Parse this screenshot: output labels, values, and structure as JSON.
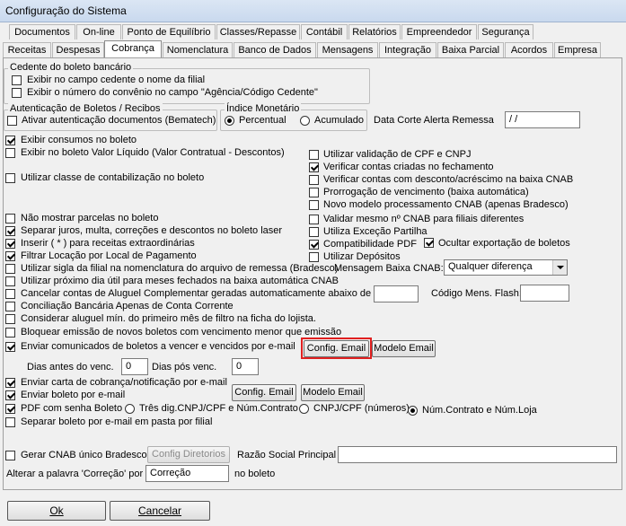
{
  "window": {
    "title": "Configuração do Sistema"
  },
  "tabs_row1": [
    "Documentos",
    "On-line",
    "Ponto de Equilíbrio",
    "Classes/Repasse",
    "Contábil",
    "Relatórios",
    "Empreendedor",
    "Segurança"
  ],
  "tabs_row2": [
    "Receitas",
    "Despesas",
    "Cobrança",
    "Nomenclatura",
    "Banco de Dados",
    "Mensagens",
    "Integração",
    "Baixa Parcial",
    "Acordos",
    "Empresa"
  ],
  "cedente": {
    "title": "Cedente do boleto bancário",
    "opt1": "Exibir no campo cedente o nome da filial",
    "opt2": "Exibir o número do convênio no campo \"Agência/Código Cedente\""
  },
  "autenticacao": {
    "title": "Autenticação de Boletos / Recibos",
    "opt": "Ativar autenticação documentos (Bematech)"
  },
  "indice": {
    "title": "Índice Monetário",
    "percentual": "Percentual",
    "acumulado": "Acumulado"
  },
  "data_corte": {
    "label": "Data Corte Alerta Remessa",
    "value": " /  /"
  },
  "left_opts": {
    "exibir_consumos": "Exibir consumos no boleto",
    "exibir_liquido": "Exibir no boleto Valor Líquido (Valor Contratual - Descontos)",
    "classe_contab": "Utilizar classe de contabilização no boleto",
    "nao_mostrar": "Não mostrar parcelas no boleto",
    "separar_juros": "Separar juros, multa, correções e descontos no boleto laser",
    "inserir": "Inserir ( * ) para receitas extraordinárias",
    "filtrar": "Filtrar Locação por Local de Pagamento",
    "sigla": "Utilizar sigla da filial na nomenclatura do arquivo de remessa (Bradesco)",
    "proximo_dia": "Utilizar próximo dia útil para meses fechados na baixa automática CNAB",
    "cancelar_aluguel": "Cancelar contas de Aluguel Complementar geradas automaticamente abaixo de R$",
    "conciliacao": "Conciliação Bancária Apenas de Conta Corrente",
    "considerar": "Considerar aluguel mín. do primeiro mês de filtro na ficha do lojista.",
    "bloquear": "Bloquear emissão de novos boletos com vencimento menor que emissão",
    "enviar_comunicados": "Enviar comunicados de boletos a vencer e vencidos por e-mail"
  },
  "right_opts": {
    "validacao_cpf": "Utilizar validação de CPF e CNPJ",
    "verificar_criadas": "Verificar contas criadas no fechamento",
    "verificar_desconto": "Verificar contas com desconto/acréscimo na baixa CNAB",
    "prorrogacao": "Prorrogação de vencimento (baixa automática)",
    "novo_modelo": "Novo modelo processamento CNAB (apenas Bradesco)",
    "validar_mesmo": "Validar mesmo nº CNAB para filiais diferentes",
    "excecao": "Utiliza Exceção Partilha",
    "compat_pdf": "Compatibilidade PDF",
    "ocultar_export": "Ocultar exportação de boletos",
    "depositos": "Utilizar Depósitos"
  },
  "mensagem_baixa": {
    "label": "Mensagem Baixa CNAB:",
    "value": "Qualquer diferença"
  },
  "codigo_flash": {
    "label": "Código Mens. Flash:"
  },
  "buttons": {
    "config_email": "Config. Email",
    "modelo_email": "Modelo Email",
    "config_diretorios": "Config Diretorios",
    "ok": "Ok",
    "cancelar": "Cancelar"
  },
  "dias": {
    "antes_label": "Dias antes do venc.",
    "antes_value": "0",
    "pos_label": "Dias pós venc.",
    "pos_value": "0"
  },
  "carta": "Enviar carta de cobrança/notificação por e-mail",
  "enviar_boleto": "Enviar boleto por e-mail",
  "pdf_senha": "PDF com senha Boleto",
  "pdf_opts": {
    "tres_dig": "Três dig.CNPJ/CPF e Núm.Contrato",
    "cnpj": "CNPJ/CPF (números)",
    "num_contrato": "Núm.Contrato e Núm.Loja"
  },
  "separar_boleto": "Separar boleto por e-mail em pasta por filial",
  "gerar_cnab": "Gerar CNAB único Bradesco",
  "razao_social": "Razão Social Principal",
  "alterar": {
    "label": "Alterar a palavra 'Correção' por",
    "value": "Correção",
    "suffix": "no boleto"
  },
  "colors": {
    "highlight": "#e02020"
  }
}
